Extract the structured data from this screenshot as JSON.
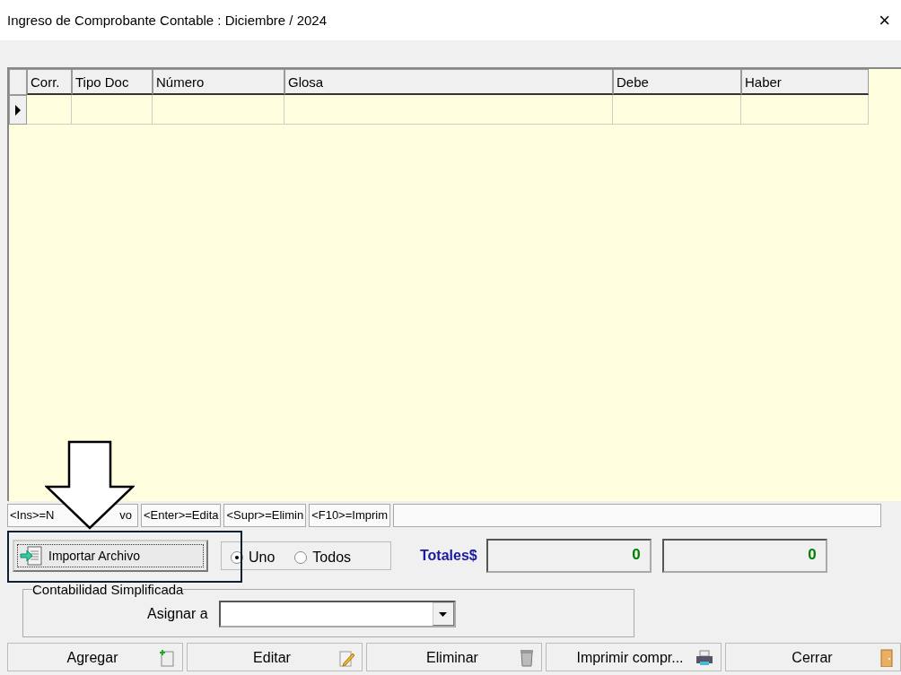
{
  "window": {
    "title": "Ingreso de Comprobante Contable : Diciembre / 2024",
    "close": "×"
  },
  "grid": {
    "columns": [
      "Corr.",
      "Tipo Doc",
      "Número",
      "Glosa",
      "Debe",
      "Haber"
    ]
  },
  "shortcuts": [
    {
      "visible": [
        "<Ins>=N",
        "vo"
      ]
    },
    {
      "visible": [
        "<Enter>=Edita"
      ]
    },
    {
      "visible": [
        "<Supr>=Elimin"
      ]
    },
    {
      "visible": [
        "<F10>=Imprim"
      ]
    }
  ],
  "import_button": "Importar Archivo",
  "scope": [
    {
      "label": "Uno",
      "selected": true
    },
    {
      "label": "Todos",
      "selected": false
    }
  ],
  "totals": {
    "label": "Totales$",
    "debe": "0",
    "haber": "0"
  },
  "simplified": {
    "title": "Contabilidad Simplificada",
    "assign_label": "Asignar a"
  },
  "buttons": [
    {
      "label": "Agregar",
      "kind": "add"
    },
    {
      "label": "Editar",
      "kind": "edit"
    },
    {
      "label": "Eliminar",
      "kind": "delete"
    },
    {
      "label": "Imprimir compr...",
      "kind": "print"
    },
    {
      "label": "Cerrar",
      "kind": "close"
    }
  ]
}
